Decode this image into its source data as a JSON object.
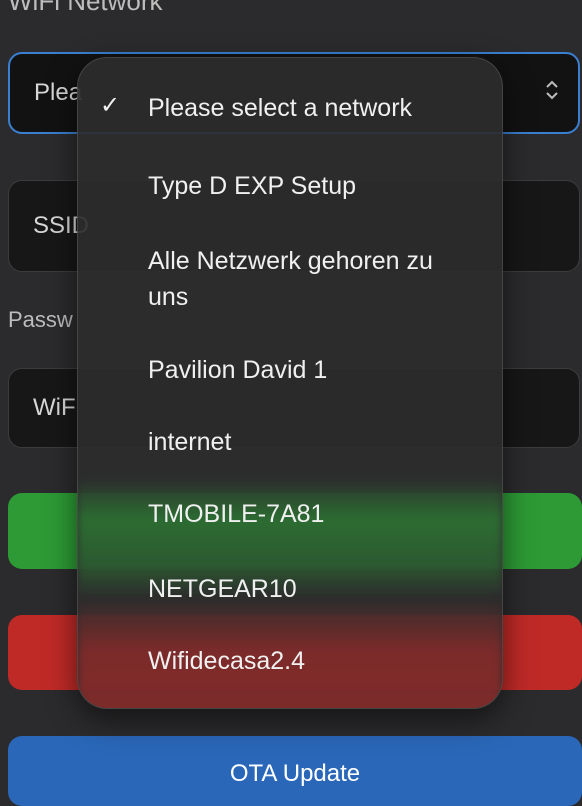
{
  "form": {
    "network_label": "WiFi Network",
    "select_value": "Plea",
    "ssid_value": "SSID",
    "password_label": "Passw",
    "wifi_value": "WiF",
    "ota_button": "OTA Update"
  },
  "dropdown": {
    "selected_check": "✓",
    "options": [
      "Please select a network",
      "Type D EXP Setup",
      "Alle Netzwerk gehoren zu uns",
      "Pavilion David 1",
      "internet",
      "TMOBILE-7A81",
      "NETGEAR10",
      "Wifidecasa2.4"
    ]
  },
  "icons": {
    "select_chevron": "⌃⌄"
  },
  "colors": {
    "green_button": "#2d9a35",
    "red_button": "#bf2a27",
    "blue_button": "#2a67b8",
    "focus_border": "#3a7fd0"
  }
}
